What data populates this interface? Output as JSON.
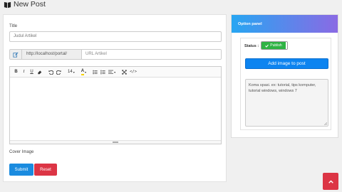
{
  "header": {
    "title": "New Post",
    "icon": "book-icon"
  },
  "form": {
    "title_label": "Title",
    "title_placeholder": "Judul Artikel",
    "url_prefix": "http://localhost/portal/",
    "url_placeholder": "URL Artikel",
    "cover_label": "Cover Image",
    "submit_label": "Submit",
    "reset_label": "Reset"
  },
  "editor": {
    "toolbar": {
      "bold": "B",
      "italic": "I",
      "underline": "U",
      "font_size": "14",
      "font_color": "A"
    }
  },
  "side_panel": {
    "title": "Option panel",
    "status_label": "Status :",
    "status_value": "Publish",
    "add_image_label": "Add image to post",
    "tags_placeholder": "Koma spasi. ex: tutorial, tips komputer, tutorial windows, windows 7"
  },
  "colors": {
    "primary": "#1a8bdf",
    "danger": "#dc3545",
    "success": "#2fb344",
    "panel_gradient_start": "#27a6f2",
    "panel_gradient_end": "#8a6ae4"
  }
}
